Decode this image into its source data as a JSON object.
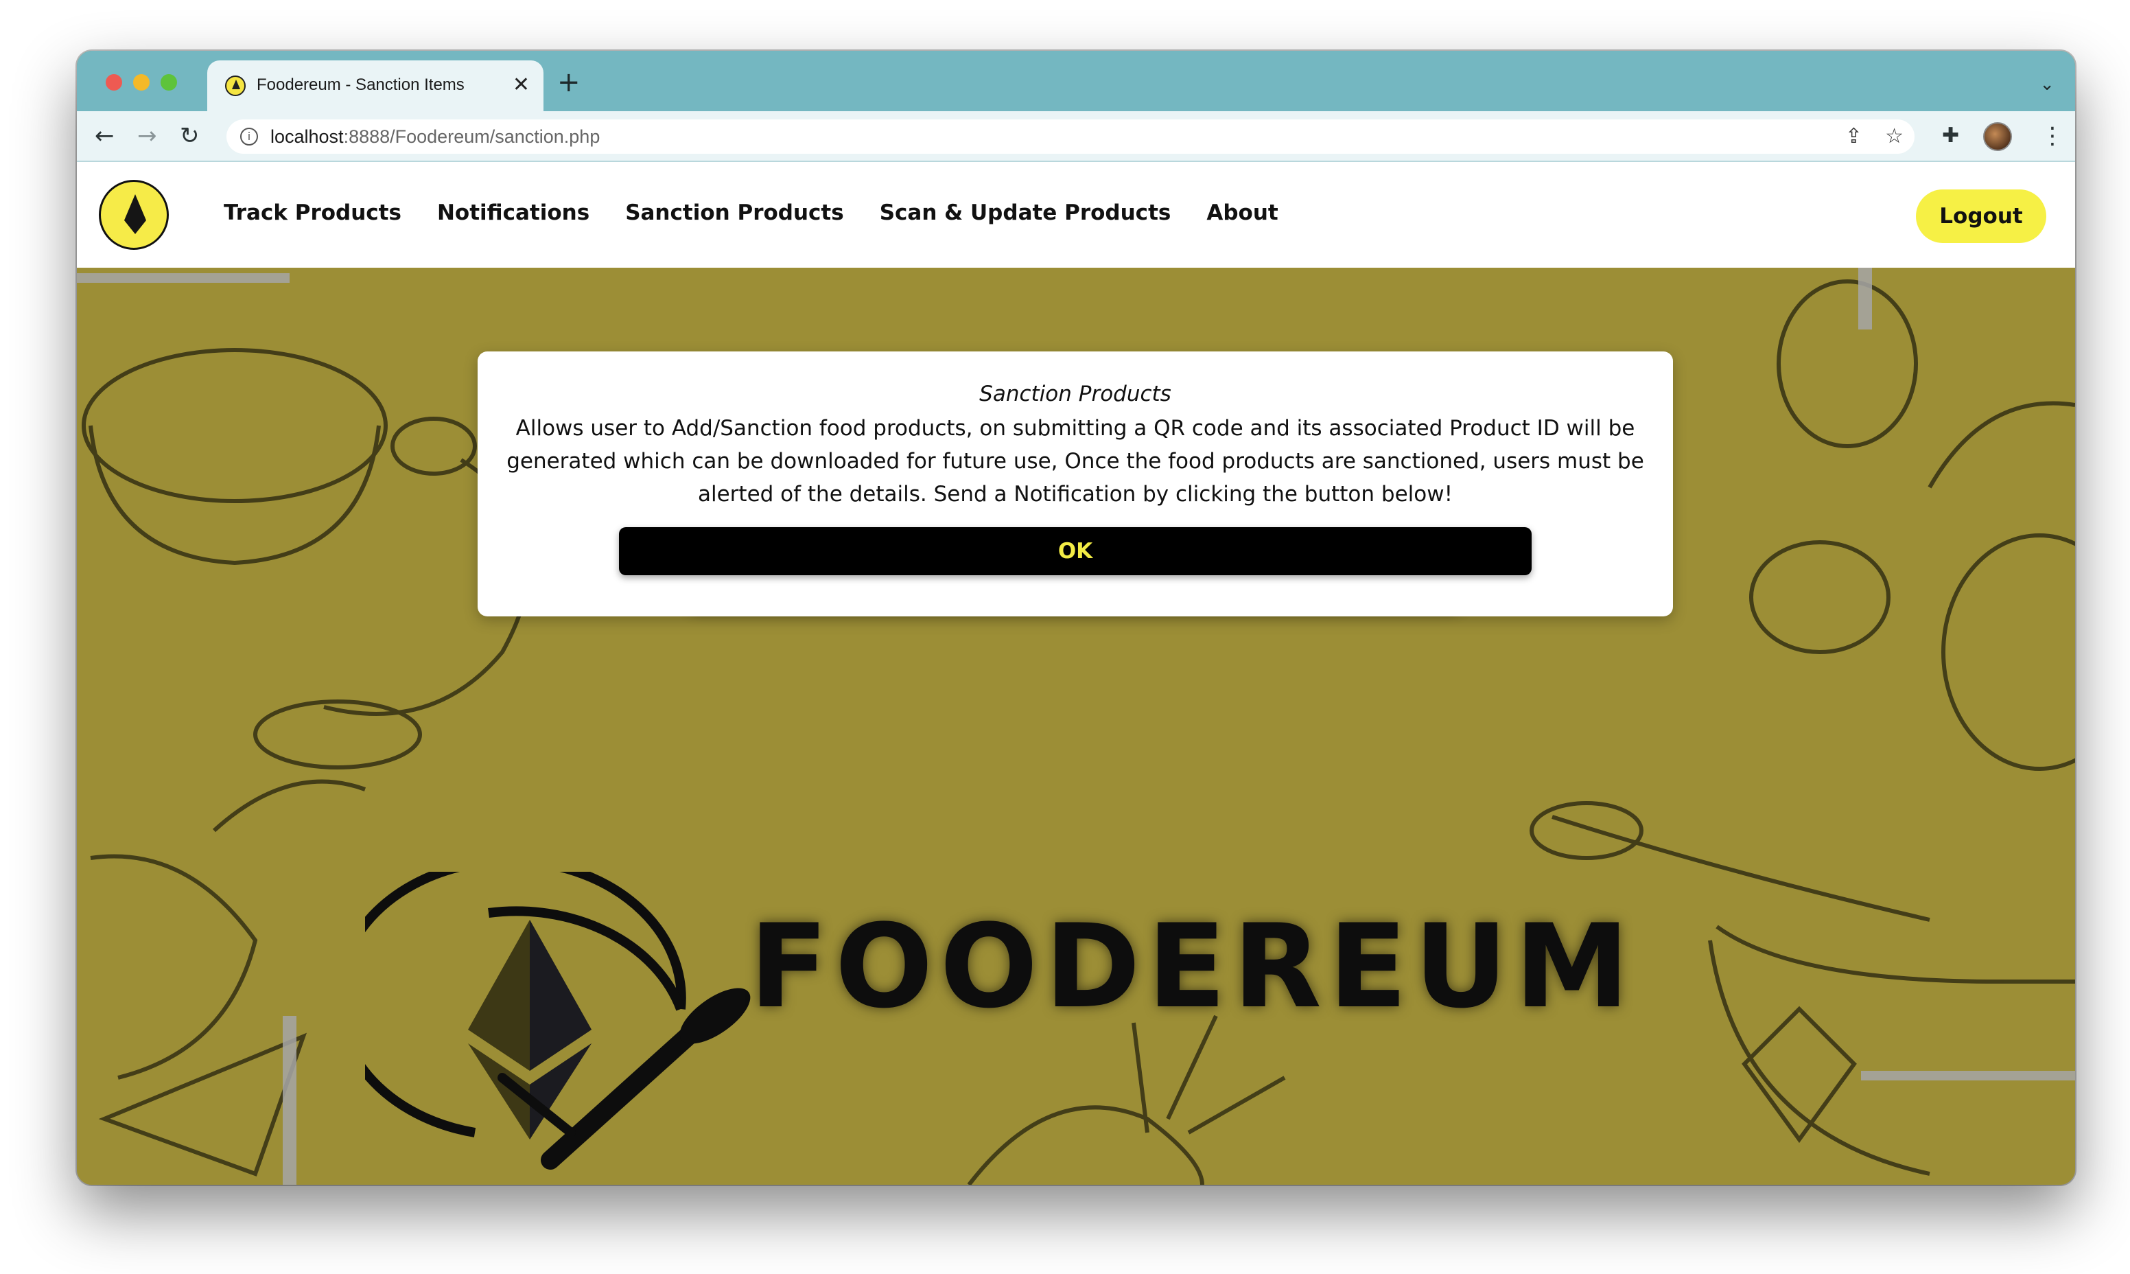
{
  "browser": {
    "tab_title": "Foodereum - Sanction Items",
    "tab_close": "✕",
    "new_tab": "+",
    "url_host": "localhost",
    "url_rest": ":8888/Foodereum/sanction.php"
  },
  "nav": {
    "links": [
      "Track Products",
      "Notifications",
      "Sanction Products",
      "Scan & Update Products",
      "About"
    ],
    "logout_label": "Logout"
  },
  "hero": {
    "brand": "FOODEREUM"
  },
  "modal": {
    "title": "Sanction Products",
    "body": "Allows user to Add/Sanction food products, on submitting a QR code and its associated Product ID will be generated which can be downloaded for future use, Once the food products are sanctioned, users must be alerted of the details. Send a Notification by clicking the button below!",
    "ok_label": "OK"
  },
  "colors": {
    "tab_strip": "#74b7c1",
    "hero_bg": "#9c8e36",
    "accent_yellow": "#f6f045",
    "button_dark": "#000000"
  },
  "icons": [
    "back-icon",
    "forward-icon",
    "reload-icon",
    "info-icon",
    "share-icon",
    "star-icon",
    "extensions-icon",
    "sidepanel-icon",
    "menu-icon",
    "tab-menu-icon"
  ]
}
